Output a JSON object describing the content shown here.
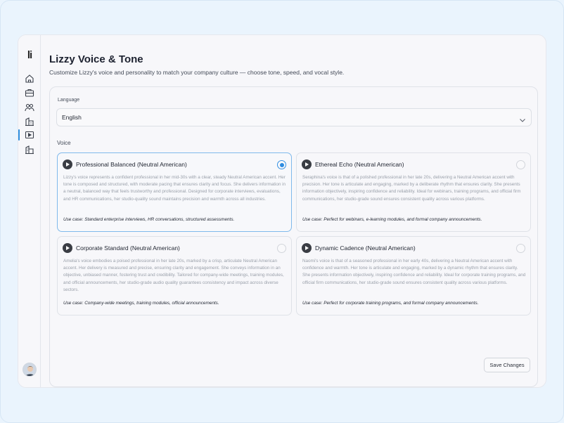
{
  "app": {
    "logo": "li"
  },
  "sidebar": {
    "items": [
      {
        "icon": "home-icon"
      },
      {
        "icon": "briefcase-icon"
      },
      {
        "icon": "users-icon"
      },
      {
        "icon": "building-icon"
      },
      {
        "icon": "video-icon",
        "active": true
      },
      {
        "icon": "office-icon"
      }
    ]
  },
  "header": {
    "title": "Lizzy Voice & Tone",
    "subtitle": "Customize Lizzy's voice and personality to match your company culture — choose tone, speed, and vocal style."
  },
  "language": {
    "label": "Language",
    "value": "English"
  },
  "voice": {
    "label": "Voice",
    "options": [
      {
        "name": "Professional Balanced (Neutral American)",
        "selected": true,
        "description": "Lizzy's voice represents a confident professional in her mid-30s with a clear, steady Neutral American accent. Her tone is composed and structured, with moderate pacing that ensures clarity and focus. She delivers information in a neutral, balanced way that feels trustworthy and professional. Designed for corporate interviews, evaluations, and HR communications, her studio-quality sound maintains precision and warmth across all industries.",
        "use_case": "Use case: Standard enterprise interviews, HR conversations, structured assessments."
      },
      {
        "name": "Ethereal Echo (Neutral American)",
        "selected": false,
        "description": "Seraphina's voice is that of a polished professional in her late 20s, delivering a Neutral American accent with precision. Her tone is articulate and engaging, marked by a deliberate rhythm that ensures clarity. She presents information objectively, inspiring confidence and reliability. Ideal for webinars, training programs, and official firm communications, her studio-grade sound ensures consistent quality across various platforms.",
        "use_case": "Use case: Perfect for webinars, e-learning modules, and formal company announcements."
      },
      {
        "name": "Corporate Standard (Neutral American)",
        "selected": false,
        "description": "Amelia's voice embodies a poised professional in her late 20s, marked by a crisp, articulate Neutral American accent. Her delivery is measured and precise, ensuring clarity and engagement. She conveys information in an objective, unbiased manner, fostering trust and credibility. Tailored for company-wide meetings, training modules, and official announcements, her studio-grade audio quality guarantees consistency and impact across diverse sectors.",
        "use_case": "Use case: Company-wide meetings, training modules, official announcements."
      },
      {
        "name": "Dynamic Cadence (Neutral American)",
        "selected": false,
        "description": "Naomi's voice is that of a seasoned professional in her early 40s, delivering a Neutral American accent with confidence and warmth. Her tone is articulate and engaging, marked by a dynamic rhythm that ensures clarity. She presents information objectively, inspiring confidence and reliability. Ideal for corporate training programs, and official firm communications, her studio-grade sound ensures consistent quality across various platforms.",
        "use_case": "Use case: Perfect for corporate training programs, and formal company announcements."
      }
    ]
  },
  "actions": {
    "save_label": "Save Changes"
  },
  "colors": {
    "accent": "#2c8be0",
    "background": "#eaf4fd"
  }
}
